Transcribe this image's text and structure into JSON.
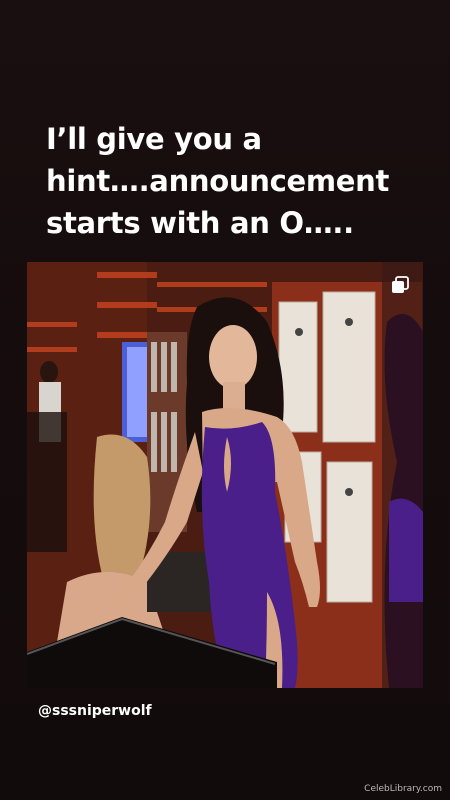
{
  "story": {
    "caption_lines": [
      "I’ll give you a",
      "hint….announcement",
      "starts with an O….."
    ],
    "photo": {
      "description_icon": "multi-image-icon",
      "link_handle": "@sssniperwolf"
    },
    "watermark": "CelebLibrary.com"
  },
  "colors": {
    "background": "#140d0e",
    "caption_text": "#ffffff",
    "dress": "#4a1f8a"
  }
}
